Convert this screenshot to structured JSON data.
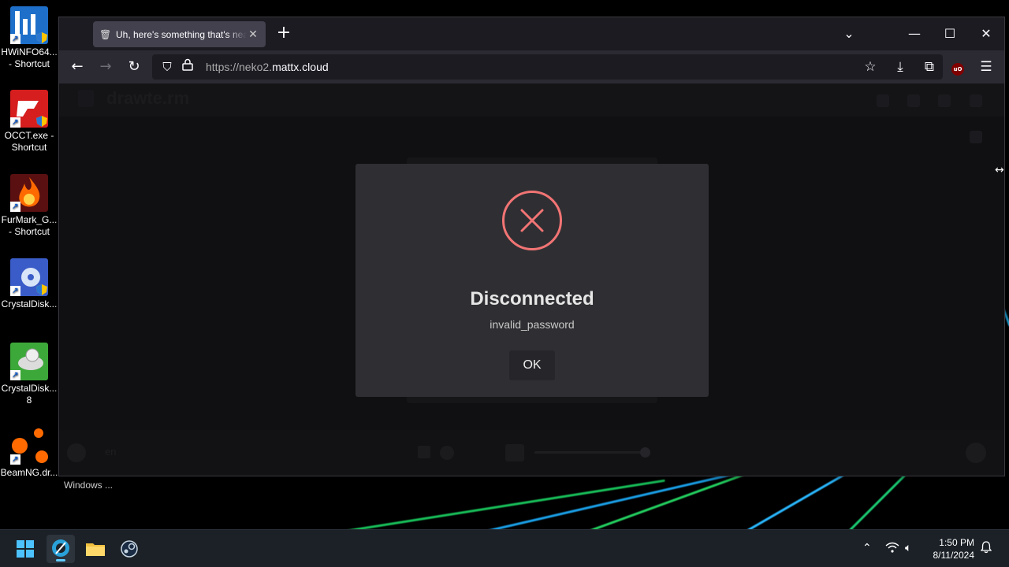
{
  "desktop": {
    "icons": [
      {
        "label": "HWiNFO64... - Shortcut",
        "icon": "hwinfo-icon"
      },
      {
        "label": "OCCT.exe - Shortcut",
        "icon": "occt-icon"
      },
      {
        "label": "FurMark_G... - Shortcut",
        "icon": "furmark-icon"
      },
      {
        "label": "CrystalDisk...",
        "icon": "crystaldisk-icon"
      },
      {
        "label": "CrystalDisk... 8",
        "icon": "crystaldisk8-icon"
      },
      {
        "label": "BeamNG.dr...",
        "icon": "beamng-icon"
      }
    ],
    "windows_label": "Windows ..."
  },
  "browser": {
    "tab": {
      "title": "Uh, here's something that's neat",
      "icon": "trash-icon"
    },
    "url": {
      "prefix": "https://neko2.",
      "domain": "mattx.cloud"
    },
    "extension_badge": "uO"
  },
  "page": {
    "app_name": "drawte.rm",
    "footer_lang": "en"
  },
  "modal": {
    "title": "Disconnected",
    "message": "invalid_password",
    "ok_label": "OK",
    "accent": "#f27474"
  },
  "taskbar": {
    "time": "1:50 PM",
    "date": "8/11/2024",
    "accent": "#60cdff"
  }
}
